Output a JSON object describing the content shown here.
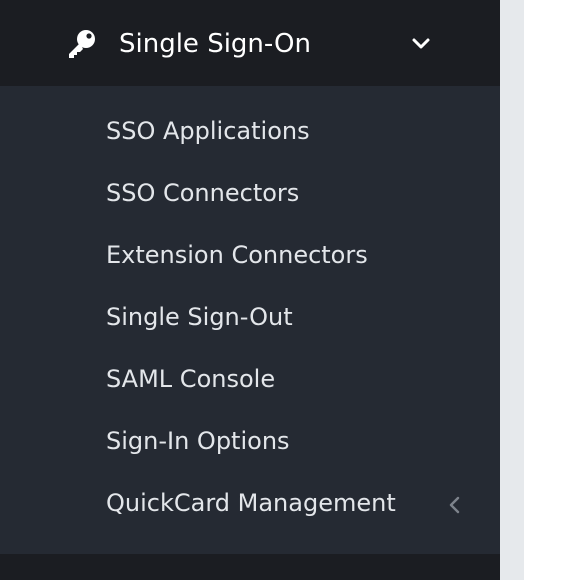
{
  "section": {
    "title": "Single Sign-On",
    "icon": "key-icon",
    "expand_icon": "chevron-down-icon"
  },
  "submenu": {
    "items": [
      {
        "label": "SSO Applications"
      },
      {
        "label": "SSO Connectors"
      },
      {
        "label": "Extension Connectors"
      },
      {
        "label": "Single Sign-Out"
      },
      {
        "label": "SAML Console"
      },
      {
        "label": "Sign-In Options"
      },
      {
        "label": "QuickCard Management",
        "icon": "chevron-left-icon"
      }
    ]
  },
  "colors": {
    "header_bg": "#1b1d22",
    "submenu_bg": "#252a33",
    "text": "#ffffff",
    "submenu_text": "#e3e6ea",
    "gutter": "#e6e9ec"
  }
}
